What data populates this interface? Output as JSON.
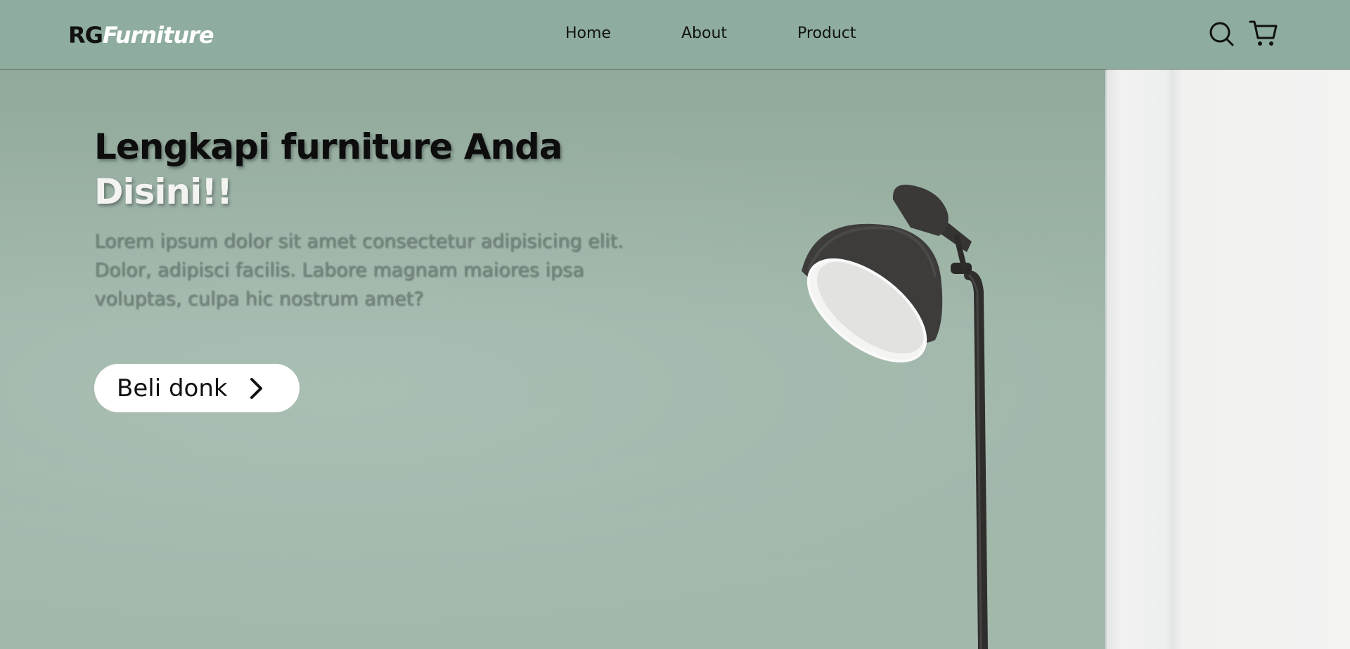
{
  "navbar": {
    "brand": {
      "part1": "RG",
      "part2": "Furniture"
    },
    "links": [
      {
        "label": "Home"
      },
      {
        "label": "About"
      },
      {
        "label": "Product"
      }
    ],
    "icons": {
      "search": "search-icon",
      "cart": "cart-icon"
    },
    "background_color": "#8ead9f"
  },
  "hero": {
    "title_line1": "Lengkapi furniture Anda",
    "title_line2": "Disini!!",
    "description": "Lorem ipsum dolor sit amet consectetur adipisicing elit. Dolor, adipisci facilis. Labore magnam maiores ipsa voluptas, culpa hic nostrum amet?",
    "cta": {
      "label": "Beli donk",
      "icon": "chevron-right-icon"
    },
    "background_color": "#a0b7aa",
    "image": "floor-lamp-against-green-wall"
  }
}
